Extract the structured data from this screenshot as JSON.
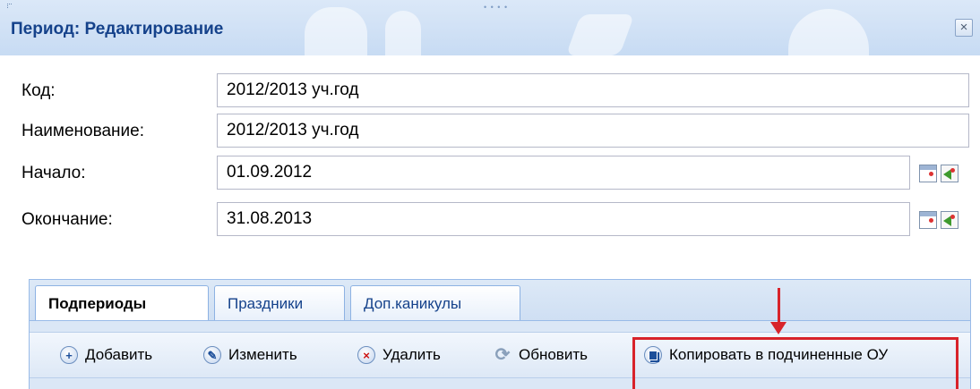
{
  "window": {
    "title": "Период: Редактирование",
    "close_symbol": "×"
  },
  "form": {
    "code": {
      "label": "Код:",
      "value": "2012/2013 уч.год"
    },
    "name": {
      "label": "Наименование:",
      "value": "2012/2013 уч.год"
    },
    "start": {
      "label": "Начало:",
      "value": "01.09.2012"
    },
    "end": {
      "label": "Окончание:",
      "value": "31.08.2013"
    }
  },
  "tabs": [
    {
      "label": "Подпериоды",
      "active": true
    },
    {
      "label": "Праздники",
      "active": false
    },
    {
      "label": "Доп.каникулы",
      "active": false
    }
  ],
  "toolbar": {
    "add": {
      "label": "Добавить",
      "icon": "plus-icon"
    },
    "edit": {
      "label": "Изменить",
      "icon": "pencil-icon"
    },
    "delete": {
      "label": "Удалить",
      "icon": "delete-icon"
    },
    "refresh": {
      "label": "Обновить",
      "icon": "refresh-icon"
    },
    "copy": {
      "label": "Копировать в подчиненные ОУ",
      "icon": "copy-icon"
    }
  },
  "colors": {
    "title_text": "#15428b",
    "annotation": "#d8232a",
    "panel_border": "#99bbe8"
  }
}
